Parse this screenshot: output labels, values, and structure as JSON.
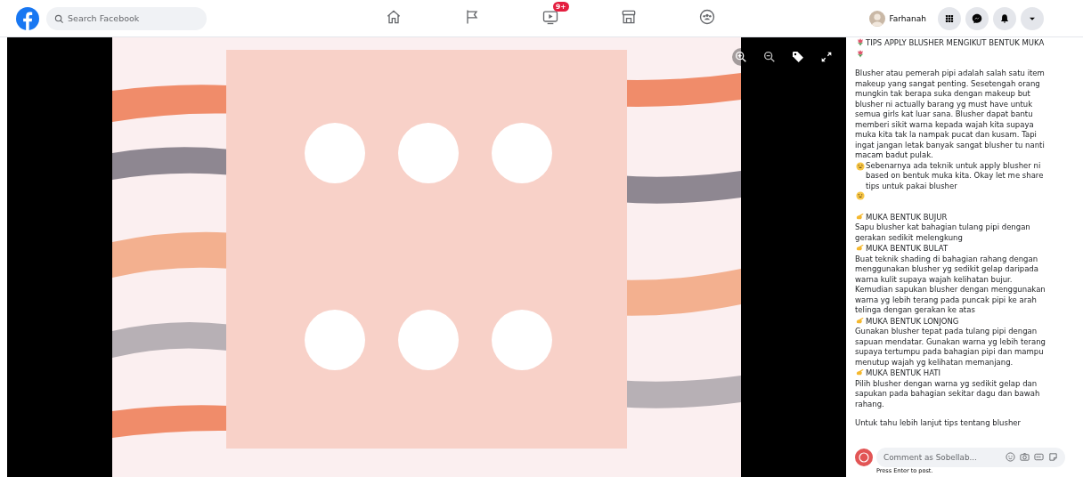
{
  "top_bar": {
    "search": {
      "placeholder": "Search Facebook"
    },
    "nav": [
      {
        "kind": "home",
        "selected": false
      },
      {
        "kind": "pages",
        "selected": false
      },
      {
        "kind": "watch",
        "selected": false,
        "badge": "9+"
      },
      {
        "kind": "marketplace",
        "selected": false
      },
      {
        "kind": "groups",
        "selected": false
      }
    ],
    "profile": {
      "name": "Farhanah"
    },
    "actions": [
      {
        "kind": "menu"
      },
      {
        "kind": "messenger"
      },
      {
        "kind": "notifications"
      },
      {
        "kind": "account"
      }
    ]
  },
  "viewer": {
    "tools": [
      {
        "kind": "zoom-in"
      },
      {
        "kind": "zoom-out"
      },
      {
        "kind": "tag"
      },
      {
        "kind": "fullscreen"
      }
    ]
  },
  "caption": {
    "title": "TIPS APPLY BLUSHER MENGIKUT BENTUK MUKA",
    "intro_before": "Blusher atau pemerah pipi adalah salah satu item makeup yang sangat penting. Sesetengah orang mungkin tak berapa suka dengan makeup but blusher ni actually barang yg must have untuk semua girls kat luar sana. Blusher dapat bantu memberi sikit warna kepada wajah kita supaya muka kita tak la nampak pucat dan kusam. Tapi ingat jangan letak banyak sangat blusher tu nanti macam badut pulak. ",
    "intro_after": "Sebenarnya ada teknik untuk apply blusher ni based on bentuk muka kita. Okay let me share tips untuk pakai blusher",
    "sections": [
      {
        "heading": "MUKA BENTUK BUJUR",
        "text": "Sapu blusher kat bahagian tulang pipi dengan gerakan sedikit melengkung"
      },
      {
        "heading": "MUKA BENTUK BULAT",
        "text": "Buat teknik shading di bahagian rahang dengan menggunakan blusher yg sedikit gelap daripada warna kulit supaya wajah kelihatan bujur. Kemudian sapukan blusher dengan menggunakan warna yg lebih terang pada puncak pipi ke arah telinga dengan gerakan ke atas"
      },
      {
        "heading": "MUKA BENTUK LONJONG",
        "text": "Gunakan blusher tepat pada tulang pipi dengan sapuan mendatar. Gunakan warna yg lebih terang supaya tertumpu pada bahagian pipi dan mampu menutup wajah yg kelihatan memanjang."
      },
      {
        "heading": "MUKA BENTUK HATI",
        "text": "Pilih blusher dengan warna yg sedikit gelap dan sapukan pada bahagian sekitar dagu dan bawah rahang."
      }
    ],
    "outro": "Untuk tahu lebih lanjut tips tentang blusher"
  },
  "comment": {
    "placeholder": "Comment as Sobellab...",
    "hint": "Press Enter to post."
  }
}
